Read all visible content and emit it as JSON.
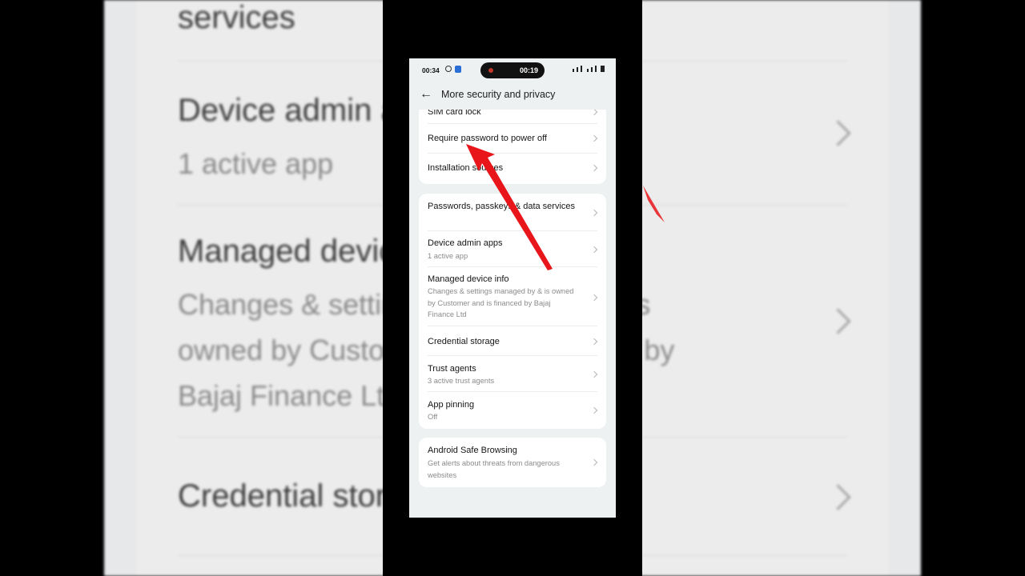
{
  "background": {
    "rows": [
      {
        "title": "services"
      },
      {
        "title": "Device admin apps",
        "sub": "1 active app"
      },
      {
        "title": "Managed device info",
        "sub": "Changes & settings managed by & is owned by Customer and is financed by Bajaj Finance Ltd"
      },
      {
        "title": "Credential storage"
      }
    ]
  },
  "status_bar": {
    "time": "00:34",
    "recording_time": "00:19"
  },
  "header": {
    "back_icon": "arrow-left-icon",
    "title": "More security and privacy"
  },
  "groups": [
    {
      "items": [
        {
          "label": "SIM card lock"
        },
        {
          "label": "Require password to power off"
        },
        {
          "label": "Installation sources"
        }
      ]
    },
    {
      "items": [
        {
          "label": "Passwords, passkeys & data services"
        },
        {
          "label": "Device admin apps",
          "sub": "1 active app"
        },
        {
          "label": "Managed device info",
          "sub": "Changes & settings managed by & is owned by Customer and is financed by Bajaj Finance Ltd"
        },
        {
          "label": "Credential storage"
        },
        {
          "label": "Trust agents",
          "sub": "3 active trust agents"
        },
        {
          "label": "App pinning",
          "sub": "Off"
        }
      ]
    },
    {
      "items": [
        {
          "label": "Android Safe Browsing",
          "sub": "Get alerts about threats from dangerous websites"
        }
      ]
    }
  ],
  "annotation": {
    "arrow_color": "#e8161b"
  }
}
